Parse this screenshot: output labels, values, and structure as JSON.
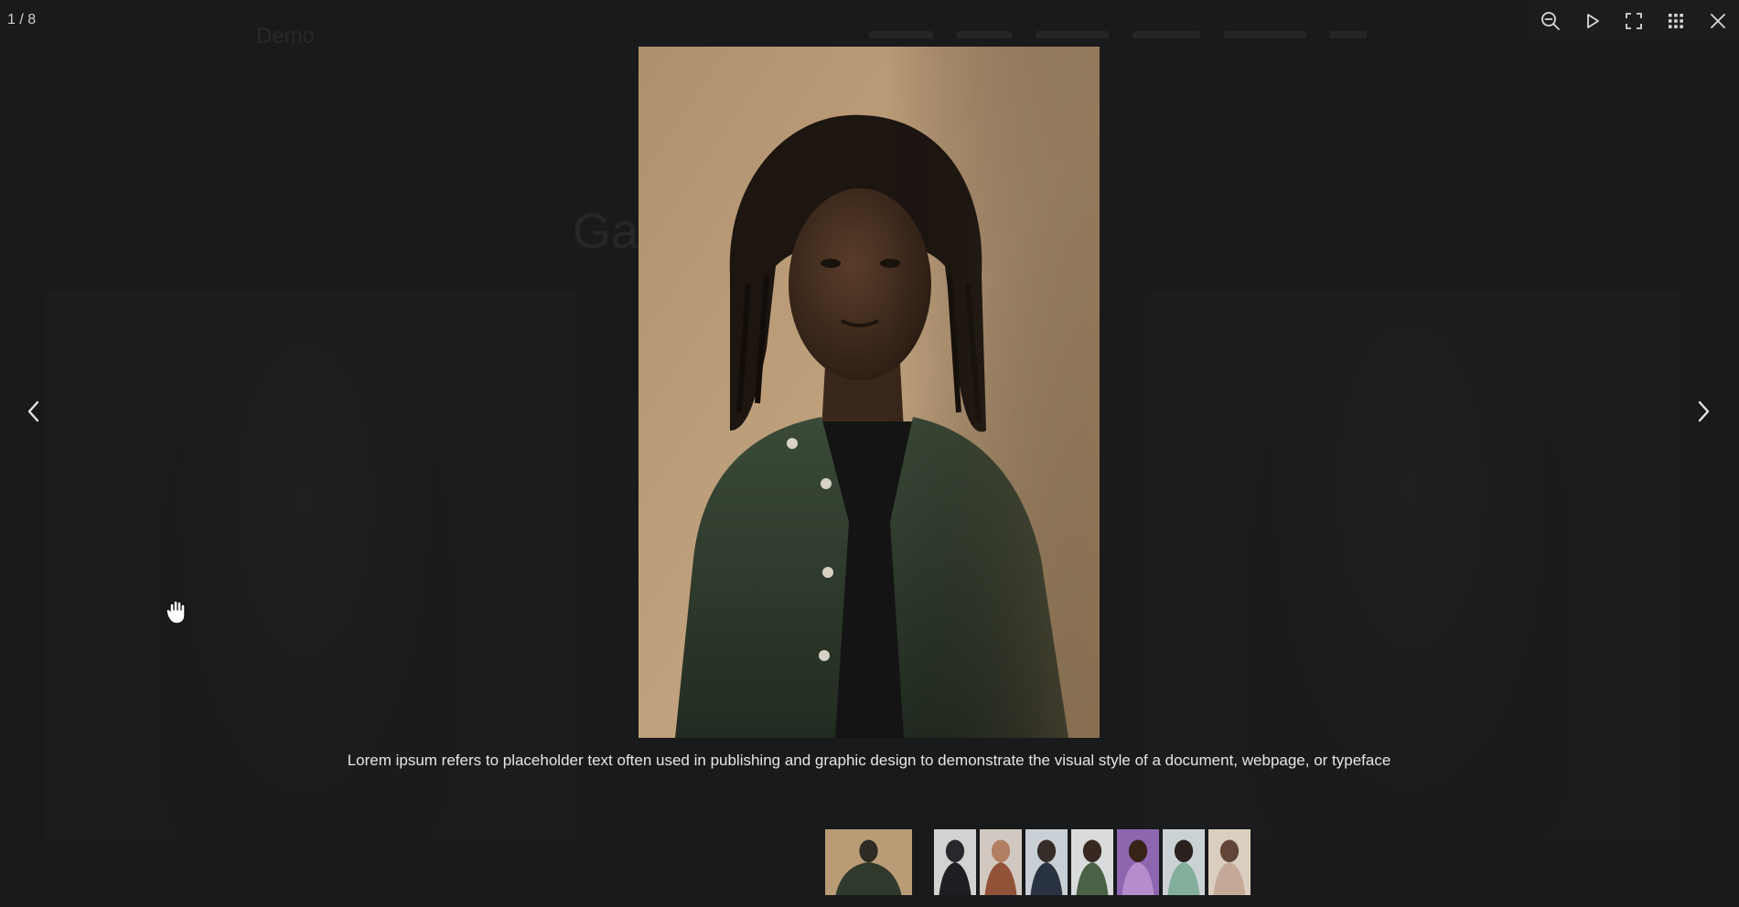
{
  "background_page": {
    "logo": "Demo",
    "title": "Gal"
  },
  "lightbox": {
    "counter": "1 / 8",
    "toolbar": {
      "icons": [
        "zoom-out-icon",
        "play-icon",
        "fullscreen-icon",
        "grid-icon",
        "close-icon"
      ]
    },
    "navigation": {
      "prev_icon": "chevron-left-icon",
      "next_icon": "chevron-right-icon"
    },
    "caption": "Lorem ipsum refers to placeholder text often used in publishing and graphic design to demonstrate the visual style of a document, webpage, or typeface",
    "current_index": 1,
    "total": 8,
    "thumbnails": [
      {
        "bg": "#b99b76",
        "figure": "#2e2a24",
        "cloth": "#2f3a2c",
        "active": true
      },
      {
        "bg": "#e9e7e4",
        "figure": "#2a2a2e",
        "cloth": "#1f1f24",
        "active": false
      },
      {
        "bg": "#e6dcd3",
        "figure": "#c48b6b",
        "cloth": "#a0593a",
        "active": false
      },
      {
        "bg": "#dde4ea",
        "figure": "#3a2f2a",
        "cloth": "#2b3545",
        "active": false
      },
      {
        "bg": "#eef0f2",
        "figure": "#3b2a22",
        "cloth": "#4f6a4a",
        "active": false
      },
      {
        "bg": "#9a6fc0",
        "figure": "#3c2418",
        "cloth": "#c79ae0",
        "active": false
      },
      {
        "bg": "#dfe6ea",
        "figure": "#2a221e",
        "cloth": "#8fbfa9",
        "active": false
      },
      {
        "bg": "#efe2d2",
        "figure": "#6b4a3a",
        "cloth": "#d9b8a6",
        "active": false
      }
    ]
  },
  "colors": {
    "backdrop": "#1d1e20",
    "toolbar_bg": "#1b1c1e",
    "icon": "#d8d9db",
    "caption_text": "#e6e6e6"
  }
}
